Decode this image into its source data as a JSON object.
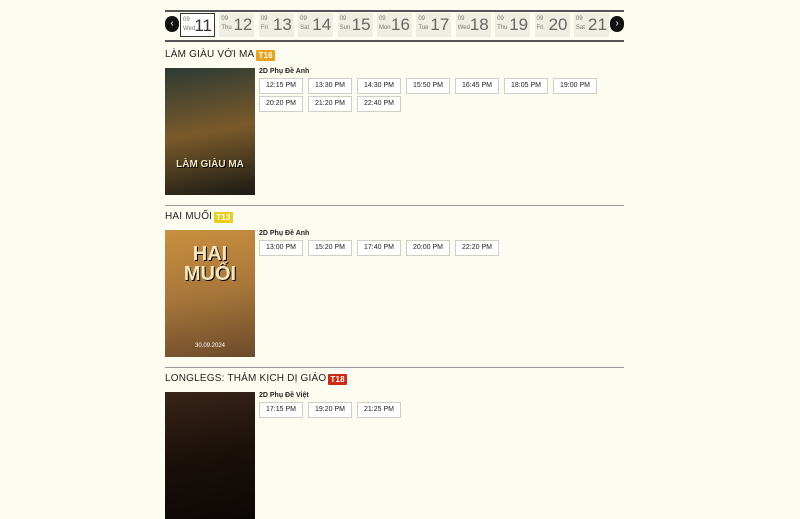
{
  "nav": {
    "prev_glyph": "‹",
    "next_glyph": "›"
  },
  "dates": [
    {
      "month": "09",
      "weekday": "Wed",
      "day": "11",
      "active": true
    },
    {
      "month": "09",
      "weekday": "Thu",
      "day": "12"
    },
    {
      "month": "09",
      "weekday": "Fri",
      "day": "13"
    },
    {
      "month": "09",
      "weekday": "Sat",
      "day": "14"
    },
    {
      "month": "09",
      "weekday": "Sun",
      "day": "15"
    },
    {
      "month": "09",
      "weekday": "Mon",
      "day": "16"
    },
    {
      "month": "09",
      "weekday": "Tue",
      "day": "17"
    },
    {
      "month": "09",
      "weekday": "Wed",
      "day": "18"
    },
    {
      "month": "09",
      "weekday": "Thu",
      "day": "19"
    },
    {
      "month": "09",
      "weekday": "Fri",
      "day": "20"
    },
    {
      "month": "09",
      "weekday": "Sat",
      "day": "21"
    }
  ],
  "movies": [
    {
      "title": "LÀM GIÀU VỚI MA",
      "rating": "T16",
      "rating_color": "#e6a31b",
      "poster_text": "LÀM GIÀU MA",
      "poster_colors": [
        "#2c3a34",
        "#7a5a2a",
        "#1a1a14"
      ],
      "format": "2D Phụ Đề Anh",
      "times": [
        "12:15 PM",
        "13:30 PM",
        "14:30 PM",
        "15:50 PM",
        "16:45 PM",
        "18:05 PM",
        "19:00 PM",
        "20:20 PM",
        "21:20 PM",
        "22:40 PM"
      ]
    },
    {
      "title": "HAI MUỐI",
      "rating": "T13",
      "rating_color": "#e8cf1e",
      "poster_text": "HAI MUỐI",
      "poster_colors": [
        "#c8903f",
        "#a8763a",
        "#6b4a2a"
      ],
      "poster_date": "30.09.2024",
      "format": "2D Phụ Đề Anh",
      "times": [
        "13:00 PM",
        "15:20 PM",
        "17:40 PM",
        "20:00 PM",
        "22:20 PM"
      ]
    },
    {
      "title": "LONGLEGS: THẢM KỊCH DỊ GIÁO",
      "rating": "T18",
      "rating_color": "#cc2a14",
      "poster_text": "",
      "poster_colors": [
        "#3a2418",
        "#1a100a",
        "#0c0806"
      ],
      "format": "2D Phụ Đề Việt",
      "times": [
        "17:15 PM",
        "19:20 PM",
        "21:25 PM"
      ]
    }
  ]
}
